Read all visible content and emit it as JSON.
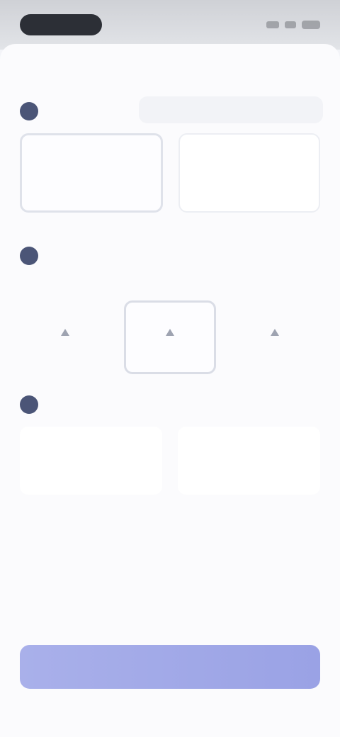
{
  "status_bar": {
    "time": "",
    "icons": [
      "signal-icon",
      "wifi-icon",
      "battery-icon"
    ]
  },
  "sheet": {
    "title": "",
    "subtitle": "",
    "search_placeholder": ""
  },
  "sections": {
    "one": {
      "step": "",
      "title": "",
      "cards": [
        {
          "title": "",
          "desc": "",
          "selected": true
        },
        {
          "title": "",
          "desc": "",
          "selected": false
        }
      ]
    },
    "two": {
      "step": "",
      "title": "",
      "note": "",
      "options": [
        {
          "icon": "triangle-icon",
          "label": "",
          "selected": false
        },
        {
          "icon": "triangle-icon",
          "label": "",
          "selected": true
        },
        {
          "icon": "triangle-icon",
          "label": "",
          "selected": false
        }
      ]
    },
    "three": {
      "step": "",
      "title": "",
      "boxes": [
        {
          "title": "",
          "desc": ""
        },
        {
          "title": "",
          "desc": ""
        }
      ]
    }
  },
  "cta": {
    "label": ""
  },
  "colors": {
    "accent": "#9aa2e5",
    "badge": "#4b5577",
    "background": "#f3f4f8",
    "sheet": "#fbfbfd"
  }
}
